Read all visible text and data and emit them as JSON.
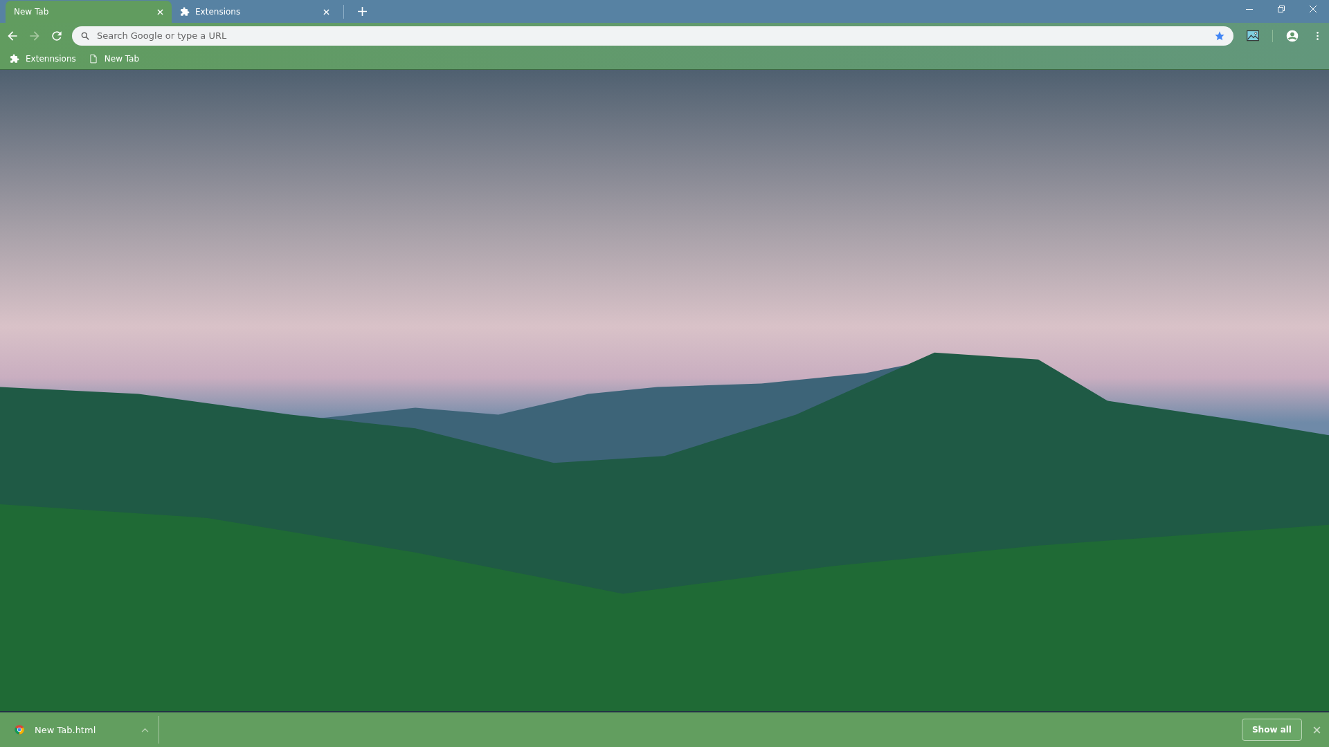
{
  "tabs": [
    {
      "label": "New Tab",
      "selected": true,
      "kind": "blank"
    },
    {
      "label": "Extensions",
      "selected": false,
      "kind": "extension"
    }
  ],
  "omnibox": {
    "placeholder": "Search Google or type a URL",
    "bookmarked": true
  },
  "bookmarks": [
    {
      "label": "Extennsions",
      "kind": "extension"
    },
    {
      "label": "New Tab",
      "kind": "page"
    }
  ],
  "download_bar": {
    "file": "New Tab.html",
    "button": "Show all"
  }
}
